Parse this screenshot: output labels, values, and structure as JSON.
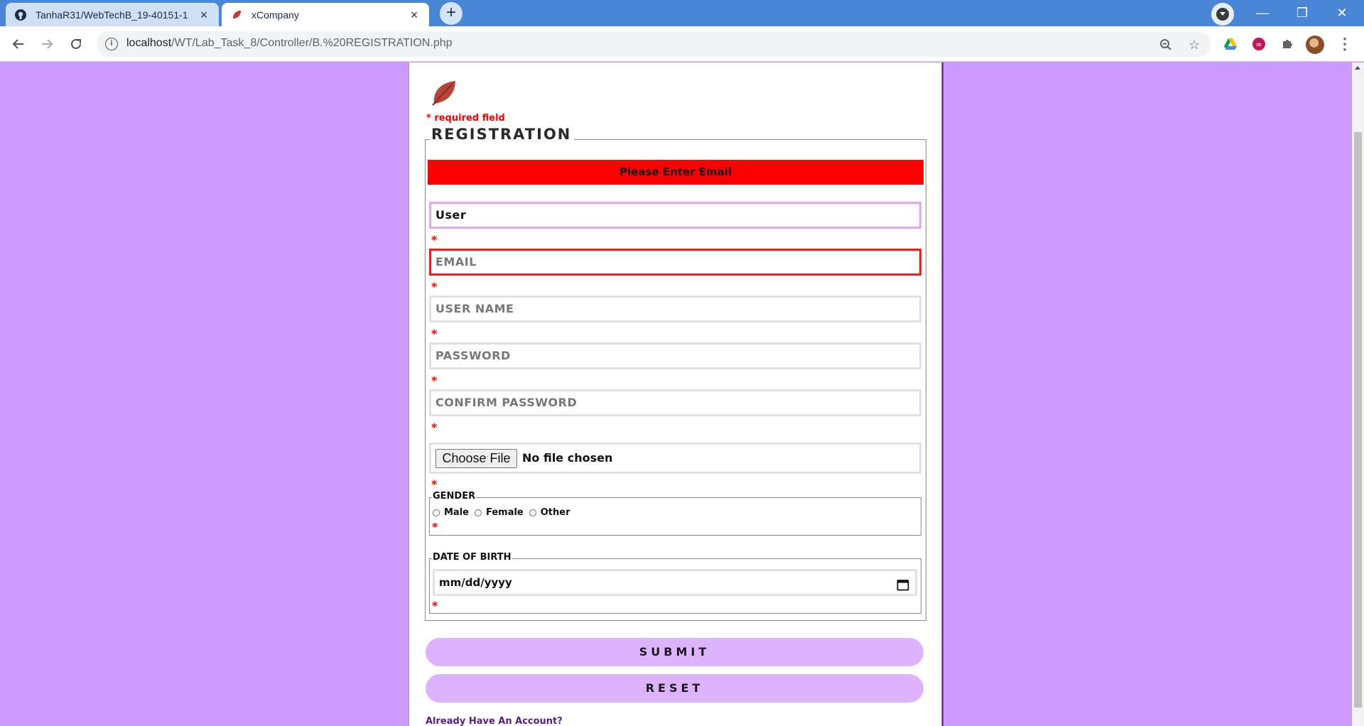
{
  "browser": {
    "tabs": [
      {
        "title": "TanhaR31/WebTechB_19-40151-1",
        "icon": "github-icon",
        "active": false
      },
      {
        "title": "xCompany",
        "icon": "leaf-icon",
        "active": true
      }
    ],
    "new_tab_label": "+",
    "url_host": "localhost",
    "url_path": "/WT/Lab_Task_8/Controller/B.%20REGISTRATION.php",
    "window_controls": {
      "minimize": "—",
      "restore": "❐",
      "close": "✕"
    }
  },
  "page": {
    "required_note": "* required field",
    "form_title": "REGISTRATION",
    "error_message": "Please Enter Email",
    "fields": {
      "name": {
        "value": "User"
      },
      "email": {
        "placeholder": "EMAIL"
      },
      "username": {
        "placeholder": "USER NAME"
      },
      "password": {
        "placeholder": "PASSWORD"
      },
      "confirm_password": {
        "placeholder": "CONFIRM PASSWORD"
      }
    },
    "required_mark": "*",
    "file_input": {
      "button_label": "Choose File",
      "status": "No file chosen"
    },
    "gender": {
      "legend": "GENDER",
      "options": [
        "Male",
        "Female",
        "Other"
      ]
    },
    "dob": {
      "legend": "DATE OF BIRTH",
      "placeholder": "mm/dd/yyyy"
    },
    "submit_label": "SUBMIT",
    "reset_label": "RESET",
    "login_link": "Already Have An Account?"
  },
  "colors": {
    "page_background": "#cc99ff",
    "error": "#ff0000",
    "button": "#ddb3ff",
    "tab_bar": "#4a86d6"
  }
}
